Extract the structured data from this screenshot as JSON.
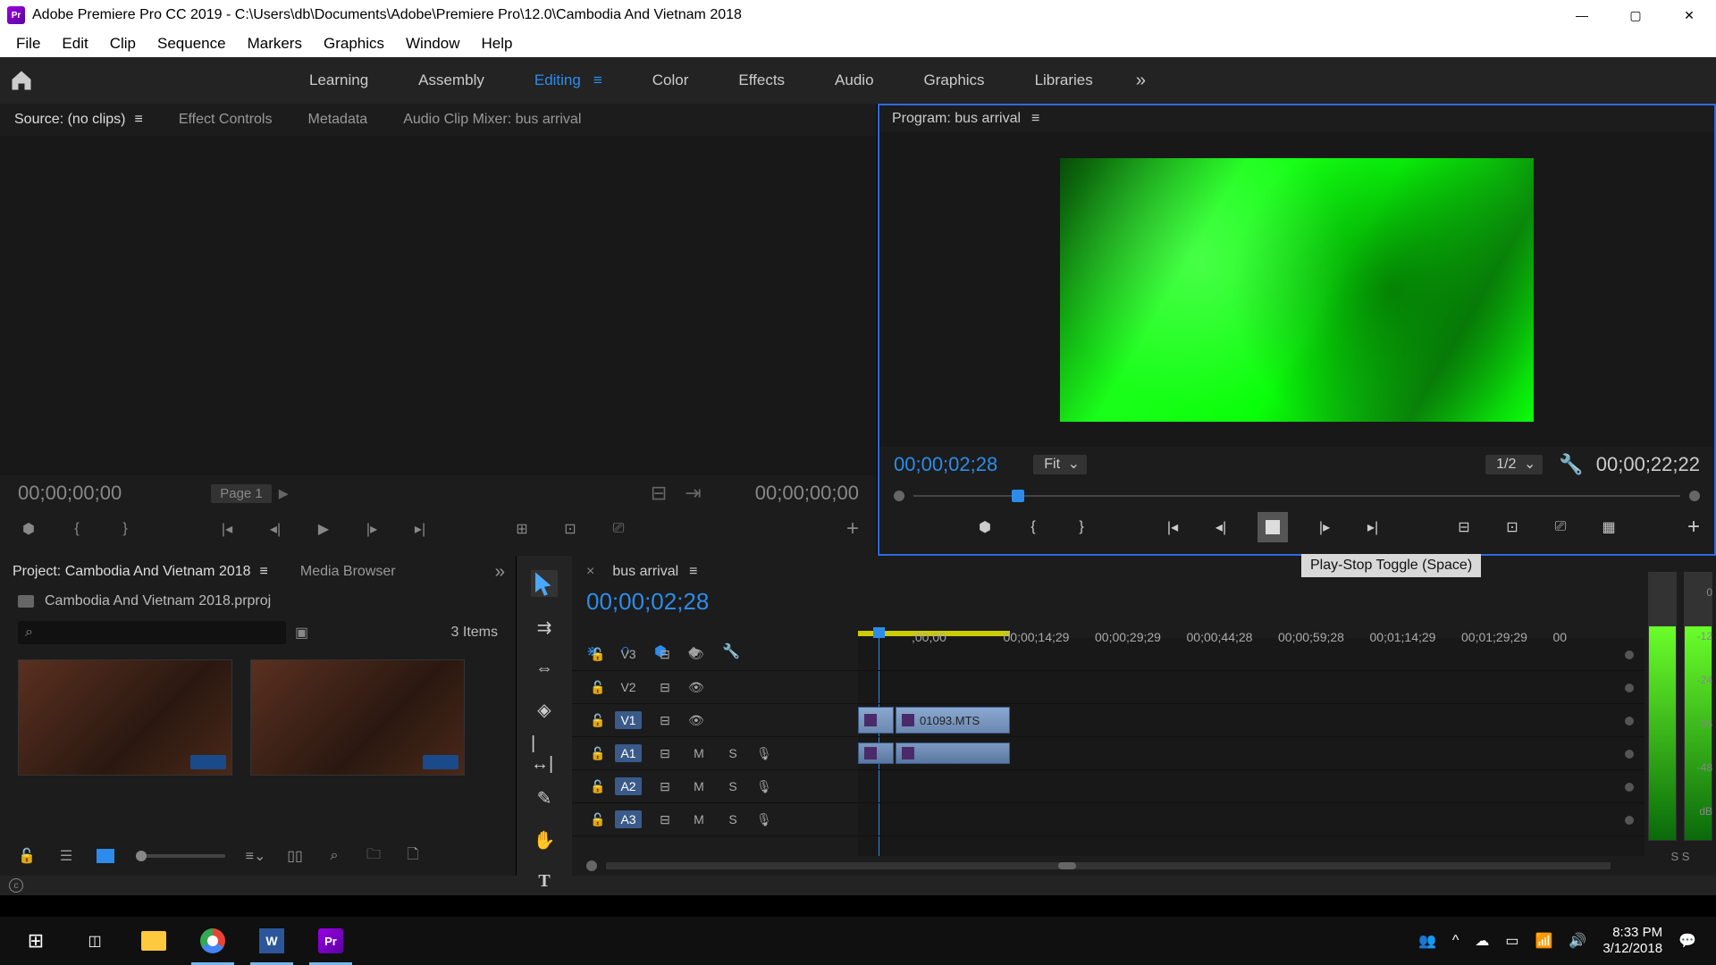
{
  "titlebar": {
    "app_name": "Adobe Premiere Pro CC 2019",
    "project_path": "C:\\Users\\db\\Documents\\Adobe\\Premiere Pro\\12.0\\Cambodia And Vietnam 2018"
  },
  "menubar": [
    "File",
    "Edit",
    "Clip",
    "Sequence",
    "Markers",
    "Graphics",
    "Window",
    "Help"
  ],
  "workspaces": {
    "items": [
      "Learning",
      "Assembly",
      "Editing",
      "Color",
      "Effects",
      "Audio",
      "Graphics",
      "Libraries"
    ],
    "active": "Editing"
  },
  "source": {
    "tabs": [
      "Source: (no clips)",
      "Effect Controls",
      "Metadata",
      "Audio Clip Mixer: bus arrival"
    ],
    "active": "Source: (no clips)",
    "tc_in": "00;00;00;00",
    "page_label": "Page 1",
    "tc_out": "00;00;00;00"
  },
  "program": {
    "title": "Program: bus arrival",
    "tc_current": "00;00;02;28",
    "fit": "Fit",
    "res": "1/2",
    "tc_duration": "00;00;22;22",
    "tooltip": "Play-Stop Toggle (Space)"
  },
  "project": {
    "tabs": [
      "Project: Cambodia And Vietnam 2018",
      "Media Browser"
    ],
    "active": "Project: Cambodia And Vietnam 2018",
    "filename": "Cambodia And Vietnam 2018.prproj",
    "item_count": "3 Items"
  },
  "timeline": {
    "seq_name": "bus arrival",
    "tc": "00;00;02;28",
    "ruler": [
      ";00;00",
      "00;00;14;29",
      "00;00;29;29",
      "00;00;44;28",
      "00;00;59;28",
      "00;01;14;29",
      "00;01;29;29",
      "00"
    ],
    "video_tracks": [
      "V3",
      "V2",
      "V1"
    ],
    "audio_tracks": [
      "A1",
      "A2",
      "A3"
    ],
    "clip_name": "01093.MTS"
  },
  "meters": {
    "labels": [
      "0",
      "-12",
      "-24",
      "-36",
      "-48",
      "dB"
    ],
    "solo": "S   S"
  },
  "taskbar": {
    "time": "8:33 PM",
    "date": "3/12/2018"
  }
}
